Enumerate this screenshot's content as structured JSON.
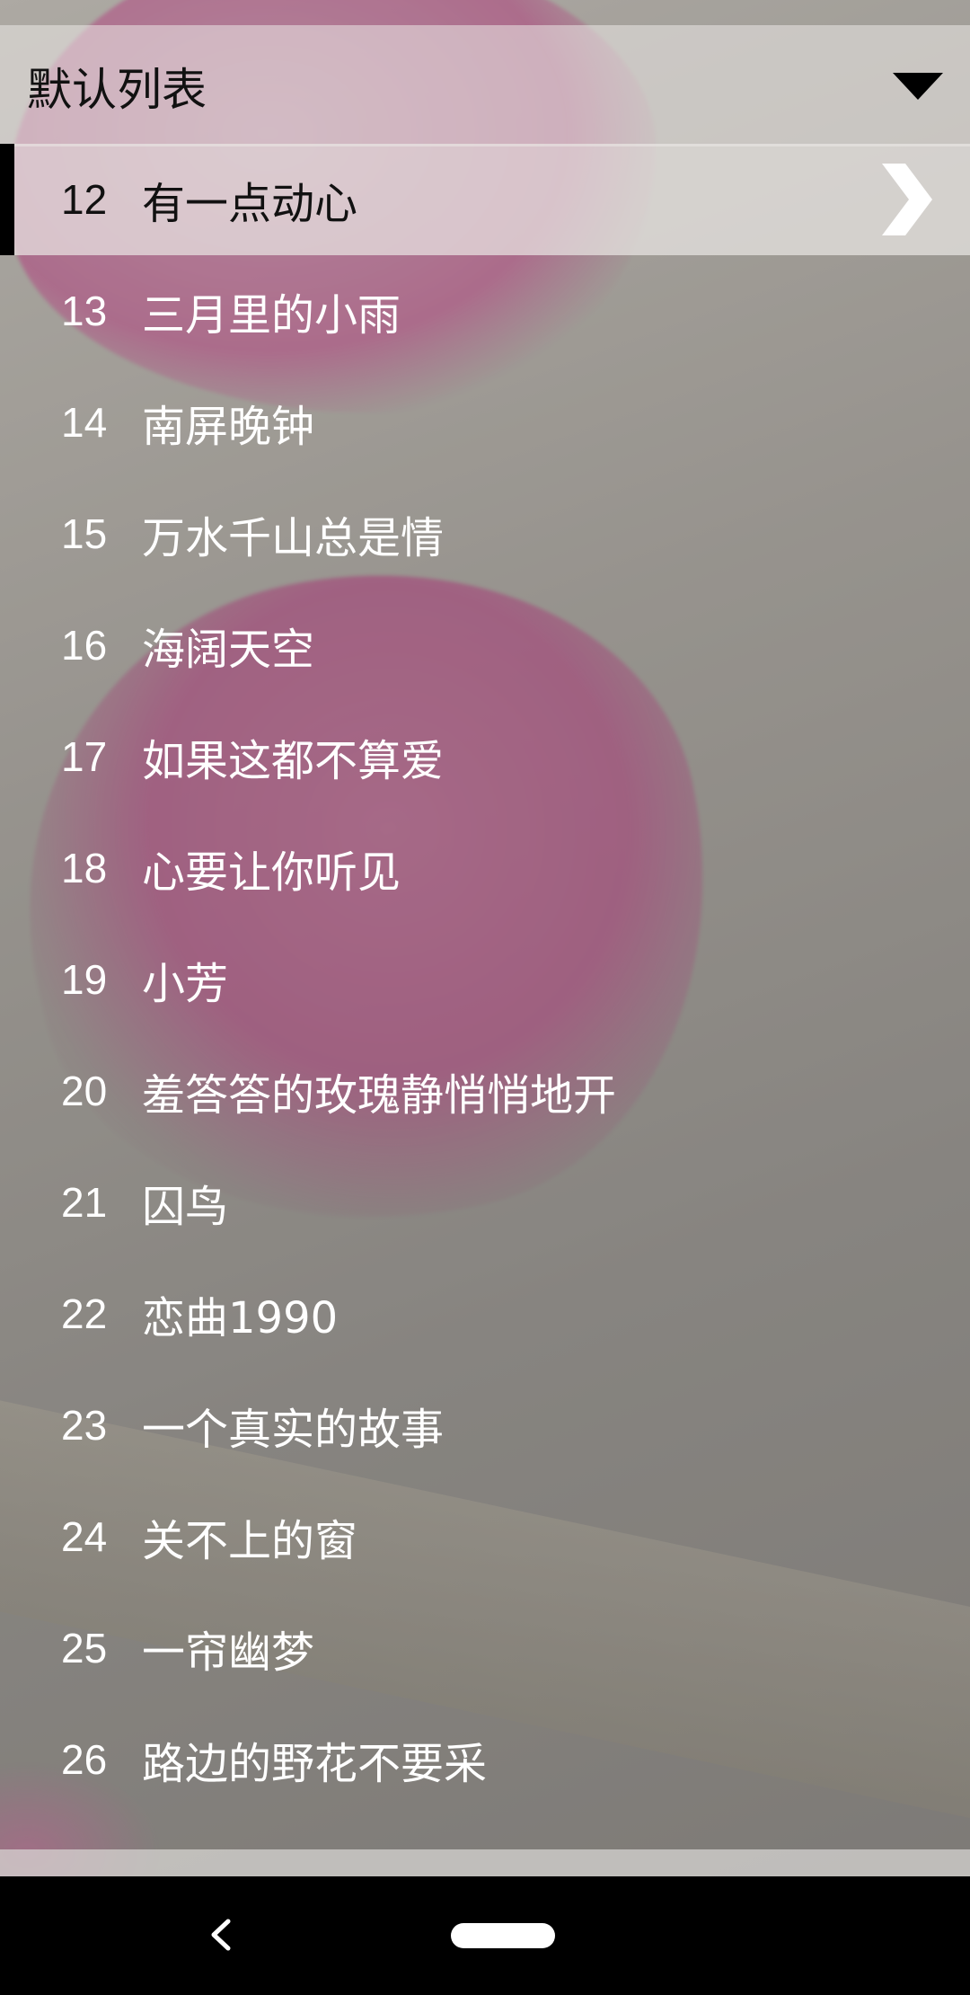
{
  "header": {
    "title": "默认列表",
    "dropdown_icon": "triangle-down-icon"
  },
  "songs": [
    {
      "num": "12",
      "title": "有一点动心",
      "active": true
    },
    {
      "num": "13",
      "title": "三月里的小雨"
    },
    {
      "num": "14",
      "title": "南屏晚钟"
    },
    {
      "num": "15",
      "title": "万水千山总是情"
    },
    {
      "num": "16",
      "title": "海阔天空"
    },
    {
      "num": "17",
      "title": "如果这都不算爱"
    },
    {
      "num": "18",
      "title": "心要让你听见"
    },
    {
      "num": "19",
      "title": "小芳"
    },
    {
      "num": "20",
      "title": "羞答答的玫瑰静悄悄地开"
    },
    {
      "num": "21",
      "title": "囚鸟"
    },
    {
      "num": "22",
      "title": "恋曲1990"
    },
    {
      "num": "23",
      "title": "一个真实的故事"
    },
    {
      "num": "24",
      "title": "关不上的窗"
    },
    {
      "num": "25",
      "title": "一帘幽梦"
    },
    {
      "num": "26",
      "title": "路边的野花不要采"
    }
  ],
  "active_row_icon": "chevron-right-icon",
  "navbar": {
    "back_icon": "back-icon",
    "home_icon": "home-pill-icon"
  },
  "colors": {
    "active_bar": "#000000",
    "row_text": "#ffffff",
    "active_text": "#111111"
  }
}
